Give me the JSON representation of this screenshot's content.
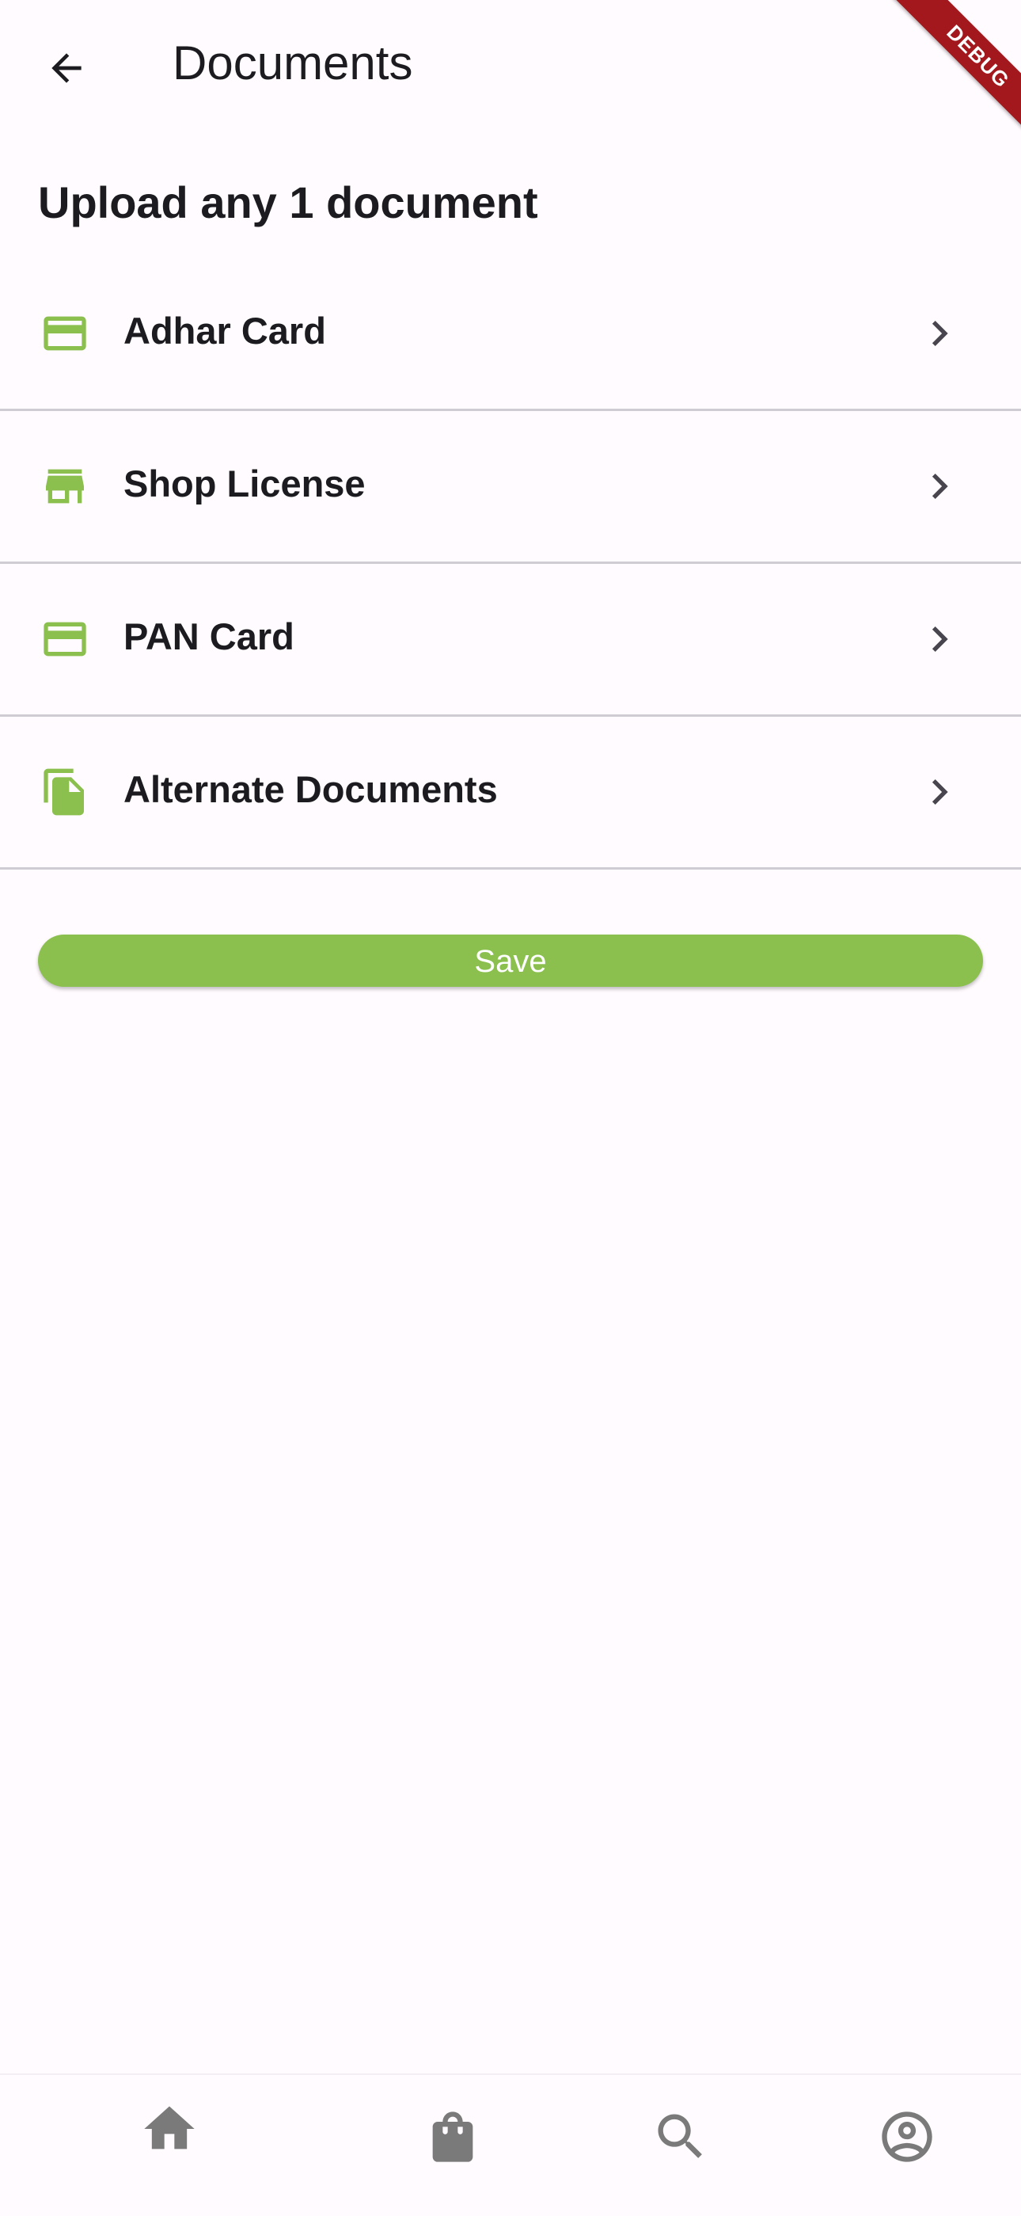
{
  "appbar": {
    "title": "Documents",
    "back_icon": "arrow-back-icon"
  },
  "debug_banner": "DEBUG",
  "heading": "Upload any 1 document",
  "documents": [
    {
      "label": "Adhar Card",
      "icon": "credit-card-icon"
    },
    {
      "label": "Shop License",
      "icon": "store-icon"
    },
    {
      "label": "PAN Card",
      "icon": "credit-card-icon"
    },
    {
      "label": "Alternate Documents",
      "icon": "file-copy-icon"
    }
  ],
  "save_label": "Save",
  "bottom_nav": [
    {
      "icon": "home-icon",
      "active": true
    },
    {
      "icon": "shopping-bag-icon",
      "active": false
    },
    {
      "icon": "search-icon",
      "active": false
    },
    {
      "icon": "account-circle-icon",
      "active": false
    }
  ],
  "colors": {
    "accent": "#8bc04f",
    "background": "#fffbfe",
    "text": "#1c1b1f",
    "divider": "#cfcdd3",
    "nav_icon": "#7a7a7a",
    "debug": "#a3181d"
  }
}
